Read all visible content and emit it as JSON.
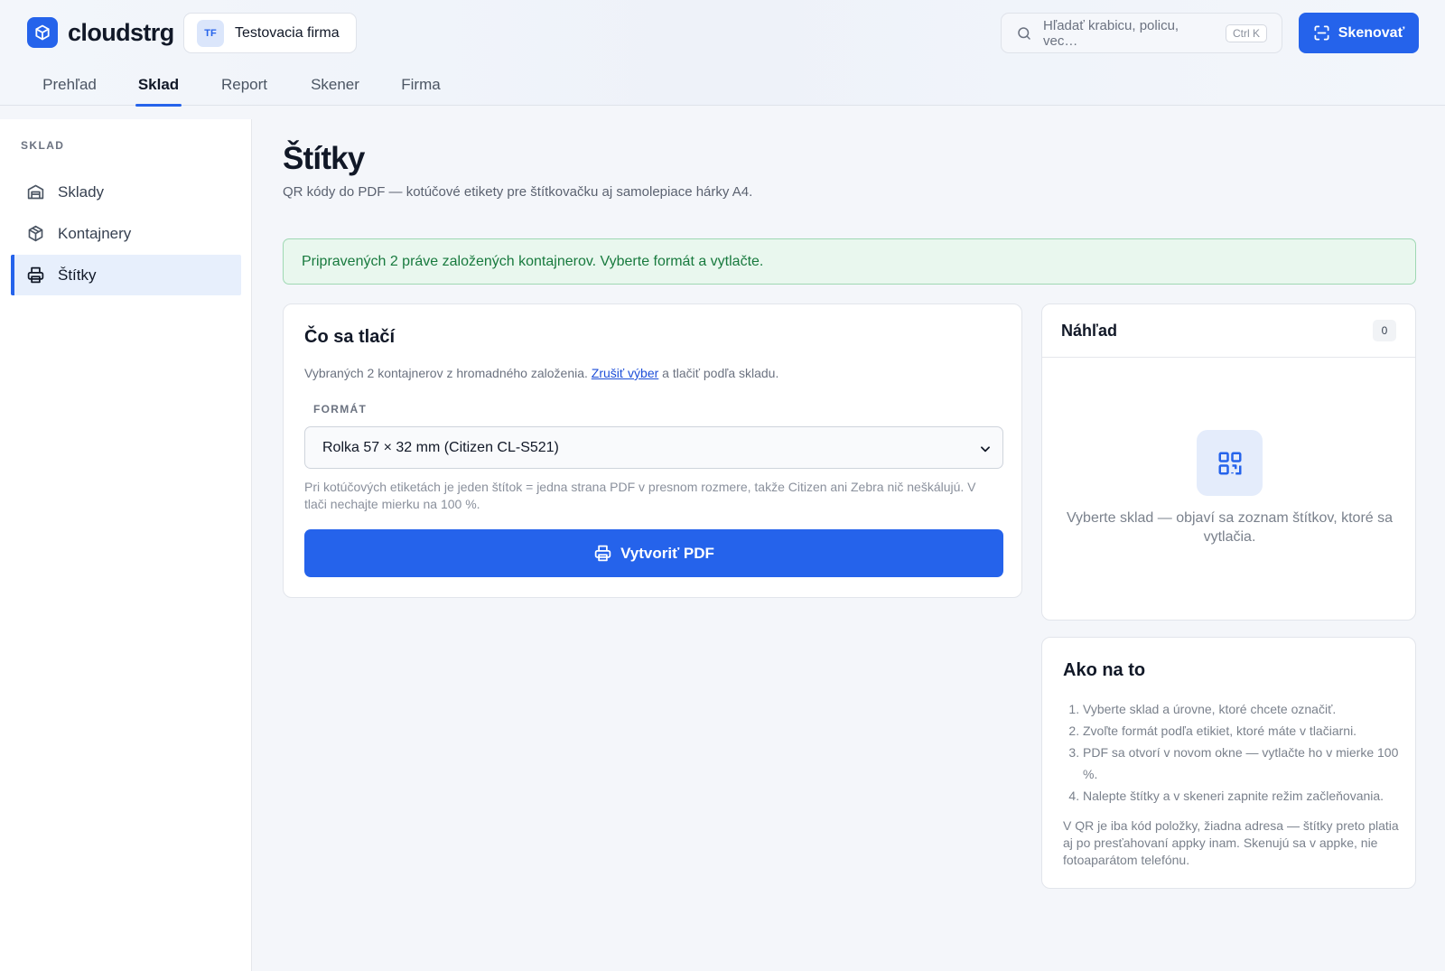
{
  "header": {
    "brand": "cloudstrg",
    "company_initials": "TF",
    "company_name": "Testovacia firma",
    "search_placeholder": "Hľadať krabicu, policu, vec…",
    "search_shortcut": "Ctrl K",
    "scan_label": "Skenovať",
    "accent_color": "#2563eb"
  },
  "nav": {
    "items": [
      {
        "label": "Prehľad"
      },
      {
        "label": "Sklad"
      },
      {
        "label": "Report"
      },
      {
        "label": "Skener"
      },
      {
        "label": "Firma"
      }
    ],
    "active": "Sklad"
  },
  "sidebar": {
    "section": "SKLAD",
    "items": [
      {
        "label": "Sklady",
        "icon": "warehouse-icon"
      },
      {
        "label": "Kontajnery",
        "icon": "box-icon"
      },
      {
        "label": "Štítky",
        "icon": "printer-icon"
      }
    ],
    "active": "Štítky"
  },
  "main": {
    "title": "Štítky",
    "subtitle": "QR kódy do PDF — kotúčové etikety pre štítkovačku aj samolepiace hárky A4.",
    "alert": "Pripravených 2 práve založených kontajnerov. Vyberte formát a vytlačte.",
    "alert_color": "#187a3e"
  },
  "print_card": {
    "title": "Čo sa tlačí",
    "desc_before": "Vybraných 2 kontajnerov z hromadného založenia.",
    "desc_link": "Zrušiť výber",
    "desc_after": "a tlačiť podľa skladu.",
    "format_label": "FORMÁT",
    "format_value": "Rolka 57 × 32 mm (Citizen CL-S521)",
    "hint": "Pri kotúčových etiketách je jeden štítok = jedna strana PDF v presnom rozmere, takže Citizen ani Zebra nič neškálujú. V tlači nechajte mierku na 100 %.",
    "button": "Vytvoriť PDF"
  },
  "preview_card": {
    "title": "Náhľad",
    "count": "0",
    "empty_text": "Vyberte sklad — objaví sa zoznam štítkov, ktoré sa vytlačia."
  },
  "howto_card": {
    "title": "Ako na to",
    "steps": [
      "Vyberte sklad a úrovne, ktoré chcete označiť.",
      "Zvoľte formát podľa etikiet, ktoré máte v tlačiarni.",
      "PDF sa otvorí v novom okne — vytlačte ho v mierke 100 %.",
      "Nalepte štítky a v skeneri zapnite režim začleňovania."
    ],
    "note": "V QR je iba kód položky, žiadna adresa — štítky preto platia aj po presťahovaní appky inam. Skenujú sa v appke, nie fotoaparátom telefónu."
  }
}
